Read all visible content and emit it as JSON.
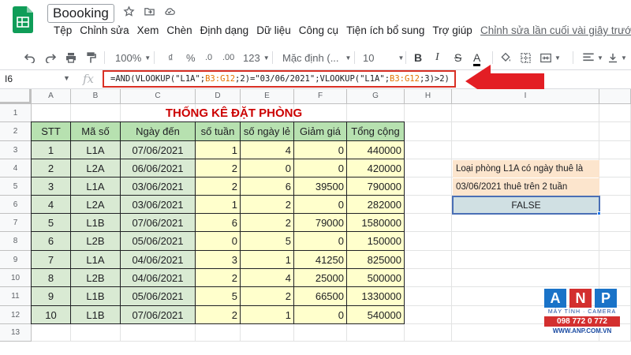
{
  "app": {
    "doc_title": "Boooking",
    "menu": [
      "Tệp",
      "Chỉnh sửa",
      "Xem",
      "Chèn",
      "Định dạng",
      "Dữ liệu",
      "Công cụ",
      "Tiện ích bổ sung",
      "Trợ giúp"
    ],
    "last_edit": "Chỉnh sửa lần cuối vài giây trước"
  },
  "toolbar": {
    "zoom": "100%",
    "currency": "₫",
    "percent": "%",
    "dec_less": ".0",
    "dec_more": ".00",
    "number_format": "123",
    "font": "Mặc định (...",
    "font_size": "10",
    "bold": "B",
    "italic": "I",
    "strike": "S",
    "text_color": "A"
  },
  "formula_bar": {
    "cell_ref": "I6",
    "fx": "fx",
    "parts": [
      "=AND(VLOOKUP(\"L1A\";",
      "B3:G12",
      ";2)=\"03/06/2021\";VLOOKUP(\"L1A\";",
      "B3:G12",
      ";3)>2)"
    ]
  },
  "columns": [
    "A",
    "B",
    "C",
    "D",
    "E",
    "F",
    "G",
    "H",
    "I"
  ],
  "rows": [
    "1",
    "2",
    "3",
    "4",
    "5",
    "6",
    "7",
    "8",
    "9",
    "10",
    "11",
    "12",
    "13"
  ],
  "sheet": {
    "title": "THỐNG KÊ ĐẶT PHÒNG",
    "headers": [
      "STT",
      "Mã số",
      "Ngày đến",
      "số tuần",
      "số ngày lẻ",
      "Giảm giá",
      "Tổng cộng"
    ],
    "data": [
      [
        "1",
        "L1A",
        "07/06/2021",
        "1",
        "4",
        "0",
        "440000"
      ],
      [
        "2",
        "L2A",
        "06/06/2021",
        "2",
        "0",
        "0",
        "420000"
      ],
      [
        "3",
        "L1A",
        "03/06/2021",
        "2",
        "6",
        "39500",
        "790000"
      ],
      [
        "4",
        "L2A",
        "03/06/2021",
        "1",
        "2",
        "0",
        "282000"
      ],
      [
        "5",
        "L1B",
        "07/06/2021",
        "6",
        "2",
        "79000",
        "1580000"
      ],
      [
        "6",
        "L2B",
        "05/06/2021",
        "0",
        "5",
        "0",
        "150000"
      ],
      [
        "7",
        "L1A",
        "04/06/2021",
        "3",
        "1",
        "41250",
        "825000"
      ],
      [
        "8",
        "L2B",
        "04/06/2021",
        "2",
        "4",
        "25000",
        "500000"
      ],
      [
        "9",
        "L1B",
        "05/06/2021",
        "5",
        "2",
        "66500",
        "1330000"
      ],
      [
        "10",
        "L1B",
        "07/06/2021",
        "2",
        "1",
        "0",
        "540000"
      ]
    ],
    "note_line1": "Loại phòng L1A có ngày thuê là",
    "note_line2": "03/06/2021 thuê trên 2 tuần",
    "result": "FALSE"
  },
  "logo": {
    "letters": [
      "A",
      "N",
      "P"
    ],
    "tagline": "MÁY TÍNH · CAMERA",
    "phone": "098 772 0 772",
    "website": "WWW.ANP.COM.VN"
  },
  "colors": {
    "header_green": "#b7e1b0",
    "body_green": "#d9ead3",
    "yellow": "#ffffcc",
    "title_red": "#cc0000",
    "highlight_red": "#d93025",
    "note_orange": "#fce5cd",
    "result_blue": "#d0e0e3"
  }
}
